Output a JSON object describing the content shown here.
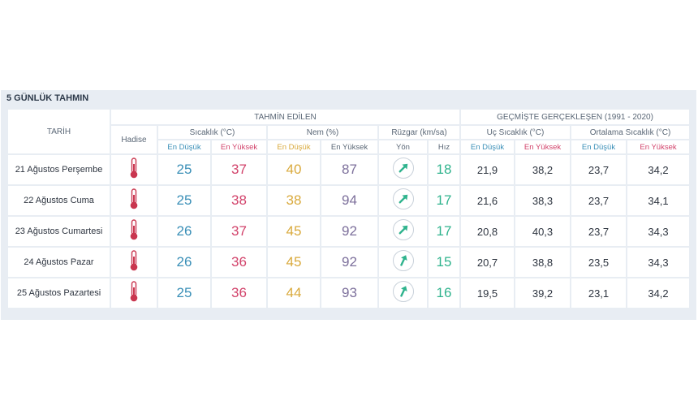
{
  "title": "5 GÜNLÜK TAHMIN",
  "headers": {
    "date": "TARİH",
    "forecast": "TAHMİN EDİLEN",
    "historical": "GEÇMİŞTE GERÇEKLEŞEN (1991 - 2020)",
    "hadise": "Hadise",
    "temperature": "Sıcaklık (°C)",
    "humidity": "Nem (%)",
    "wind": "Rüzgar (km/sa)",
    "extreme_temp": "Uç Sıcaklık (°C)",
    "avg_temp": "Ortalama Sıcaklık (°C)",
    "low": "En Düşük",
    "high": "En Yüksek",
    "direction": "Yön",
    "speed": "Hız"
  },
  "colors": {
    "low": "#3a8fb7",
    "high": "#d2436b",
    "humidity_low": "#d9a93b",
    "humidity_high": "#7c6f9b",
    "wind": "#2fb38d"
  },
  "rows": [
    {
      "date": "21 Ağustos Perşembe",
      "icon": "thermometer-icon",
      "temp_low": "25",
      "temp_high": "37",
      "hum_low": "40",
      "hum_high": "87",
      "wind_dir": "northeast",
      "wind_speed": "18",
      "ext_low": "21,9",
      "ext_high": "38,2",
      "avg_low": "23,7",
      "avg_high": "34,2"
    },
    {
      "date": "22 Ağustos Cuma",
      "icon": "thermometer-icon",
      "temp_low": "25",
      "temp_high": "38",
      "hum_low": "38",
      "hum_high": "94",
      "wind_dir": "northeast",
      "wind_speed": "17",
      "ext_low": "21,6",
      "ext_high": "38,3",
      "avg_low": "23,7",
      "avg_high": "34,1"
    },
    {
      "date": "23 Ağustos Cumartesi",
      "icon": "thermometer-icon",
      "temp_low": "26",
      "temp_high": "37",
      "hum_low": "45",
      "hum_high": "92",
      "wind_dir": "northeast",
      "wind_speed": "17",
      "ext_low": "20,8",
      "ext_high": "40,3",
      "avg_low": "23,7",
      "avg_high": "34,3"
    },
    {
      "date": "24 Ağustos Pazar",
      "icon": "thermometer-icon",
      "temp_low": "26",
      "temp_high": "36",
      "hum_low": "45",
      "hum_high": "92",
      "wind_dir": "north-northeast",
      "wind_speed": "15",
      "ext_low": "20,7",
      "ext_high": "38,8",
      "avg_low": "23,5",
      "avg_high": "34,3"
    },
    {
      "date": "25 Ağustos Pazartesi",
      "icon": "thermometer-icon",
      "temp_low": "25",
      "temp_high": "36",
      "hum_low": "44",
      "hum_high": "93",
      "wind_dir": "north-northeast",
      "wind_speed": "16",
      "ext_low": "19,5",
      "ext_high": "39,2",
      "avg_low": "23,1",
      "avg_high": "34,2"
    }
  ]
}
